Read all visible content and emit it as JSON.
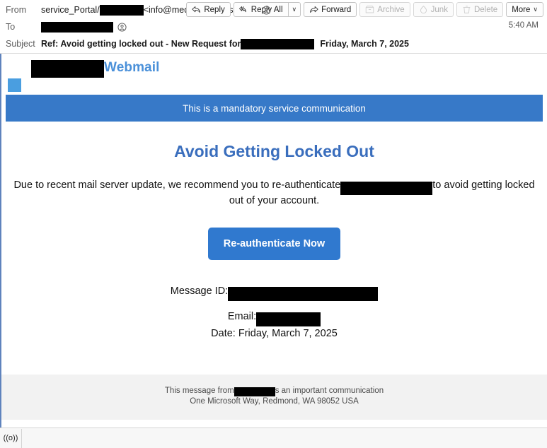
{
  "header": {
    "from": {
      "label": "From",
      "value_prefix": "service_Portal/",
      "redacted_width": 62,
      "value_suffix": "<info@medloqservices.com>"
    },
    "to": {
      "label": "To",
      "redacted_width": 102
    },
    "subject": {
      "label": "Subject",
      "text": "Ref: Avoid getting locked out - New Request for",
      "redacted_width": 104,
      "date": "Friday, March 7, 2025"
    },
    "time": "5:40 AM"
  },
  "toolbar": {
    "reply": "Reply",
    "reply_all": "Reply All",
    "reply_all_caret": "∨",
    "forward": "Forward",
    "archive": "Archive",
    "junk": "Junk",
    "delete": "Delete",
    "more": "More",
    "more_caret": "∨"
  },
  "message": {
    "brand_word": "Webmail",
    "brand_redacted_width": 103,
    "banner": "This is a mandatory service communication",
    "headline": "Avoid Getting Locked Out",
    "body_before": "Due to recent mail server update, we recommend you to re-authenticate",
    "body_redacted_width": 130,
    "body_after": "to avoid getting locked out of your account.",
    "cta_label": "Re-authenticate Now",
    "message_id_label": "Message ID:",
    "message_id_redacted_width": 212,
    "email_label": "Email:",
    "email_redacted_width": 91,
    "date_label": "Date:",
    "date_value": "Friday, March 7, 2025",
    "footer_line1_before": "This message from",
    "footer_line1_redacted_width": 58,
    "footer_line1_after": "s an important communication",
    "footer_line2": "One Microsoft Way, Redmond, WA 98052 USA"
  },
  "statusbar": {
    "broadcast_icon": "((o))"
  },
  "colors": {
    "brand_blue": "#4a90d9",
    "brand_square": "#4a9ee0",
    "banner_blue": "#3779c8",
    "headline_blue": "#3a6ebd",
    "cta_blue": "#3079cf",
    "pane_border": "#5f83bd",
    "footer_bg": "#f2f2f2"
  }
}
